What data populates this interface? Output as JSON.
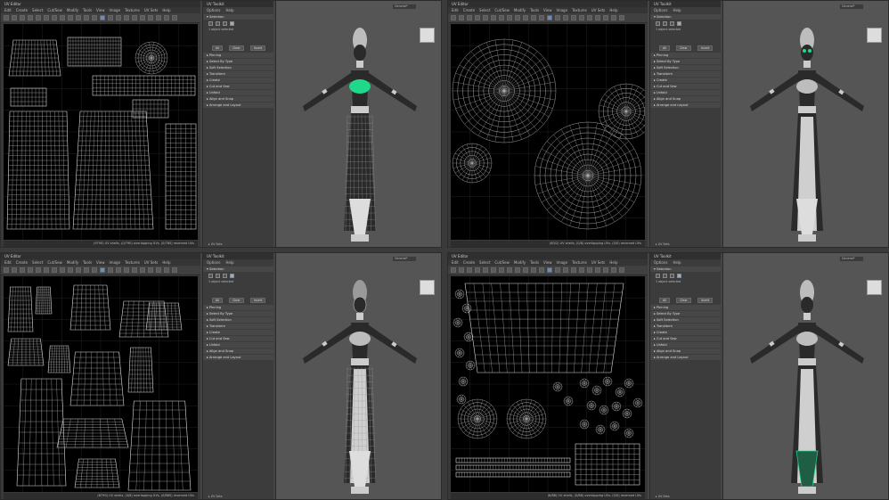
{
  "windows": [
    {
      "uv_editor": {
        "title": "UV Editor",
        "menus": [
          "Edit",
          "Create",
          "Select",
          "Cut/Sew",
          "Modify",
          "Tools",
          "View",
          "Image",
          "Textures",
          "UV Sets",
          "Help"
        ],
        "status": "(9790) UV shells, (0/790) overlapping UVs, (0/780) reversed UVs"
      },
      "toolkit": {
        "title": "UV Toolkit",
        "menus": [
          "Options",
          "Help"
        ],
        "selected_count": "1 object selected",
        "sections": [
          "Pinning",
          "Select By Type",
          "Soft Selection",
          "Transform",
          "Create",
          "Cut and Sew",
          "Unfold",
          "Align and Snap",
          "Arrange and Layout"
        ],
        "footer": "UV Sets"
      },
      "viewport": {
        "workspace": "General*"
      },
      "highlight": "chest",
      "uv_layout": "clothes"
    },
    {
      "uv_editor": {
        "title": "UV Editor",
        "menus": [
          "Edit",
          "Create",
          "Select",
          "Cut/Sew",
          "Modify",
          "Tools",
          "View",
          "Image",
          "Textures",
          "UV Sets",
          "Help"
        ],
        "status": "(80/2) UV shells, (0/8) overlapping UVs, (0/0) reversed UVs"
      },
      "toolkit": {
        "title": "UV Toolkit",
        "menus": [
          "Options",
          "Help"
        ],
        "selected_count": "1 object selected",
        "sections": [
          "Pinning",
          "Select By Type",
          "Soft Selection",
          "Transform",
          "Create",
          "Cut and Sew",
          "Unfold",
          "Align and Snap",
          "Arrange and Layout"
        ],
        "footer": "UV Sets"
      },
      "viewport": {
        "workspace": "General*"
      },
      "highlight": "eyes",
      "uv_layout": "circles"
    },
    {
      "uv_editor": {
        "title": "UV Editor",
        "menus": [
          "Edit",
          "Create",
          "Select",
          "Cut/Sew",
          "Modify",
          "Tools",
          "View",
          "Image",
          "Textures",
          "UV Sets",
          "Help"
        ],
        "status": "(8790) UV shells, (0/8) overlapping UVs, (0/880) reversed UVs"
      },
      "toolkit": {
        "title": "UV Toolkit",
        "menus": [
          "Options",
          "Help"
        ],
        "selected_count": "1 object selected",
        "sections": [
          "Pinning",
          "Select By Type",
          "Soft Selection",
          "Transform",
          "Create",
          "Cut and Sew",
          "Unfold",
          "Align and Snap",
          "Arrange and Layout"
        ],
        "footer": "UV Sets"
      },
      "viewport": {
        "workspace": "General*"
      },
      "highlight": "body-wire",
      "uv_layout": "body"
    },
    {
      "uv_editor": {
        "title": "UV Editor",
        "menus": [
          "Edit",
          "Create",
          "Select",
          "Cut/Sew",
          "Modify",
          "Tools",
          "View",
          "Image",
          "Textures",
          "UV Sets",
          "Help"
        ],
        "status": "(8/88) UV shells, (0/88) overlapping UVs, (0/0) reversed UVs"
      },
      "toolkit": {
        "title": "UV Toolkit",
        "menus": [
          "Options",
          "Help"
        ],
        "selected_count": "1 object selected",
        "sections": [
          "Pinning",
          "Select By Type",
          "Soft Selection",
          "Transform",
          "Create",
          "Cut and Sew",
          "Unfold",
          "Align and Snap",
          "Arrange and Layout"
        ],
        "footer": "UV Sets"
      },
      "viewport": {
        "workspace": "General*"
      },
      "highlight": "drum",
      "uv_layout": "drum"
    }
  ],
  "colors": {
    "highlight": "#1fd88a",
    "wire": "#e8e8e8",
    "bg": "#000000",
    "figure": "#2a2a2a",
    "skirt": "#cfcfcf"
  }
}
